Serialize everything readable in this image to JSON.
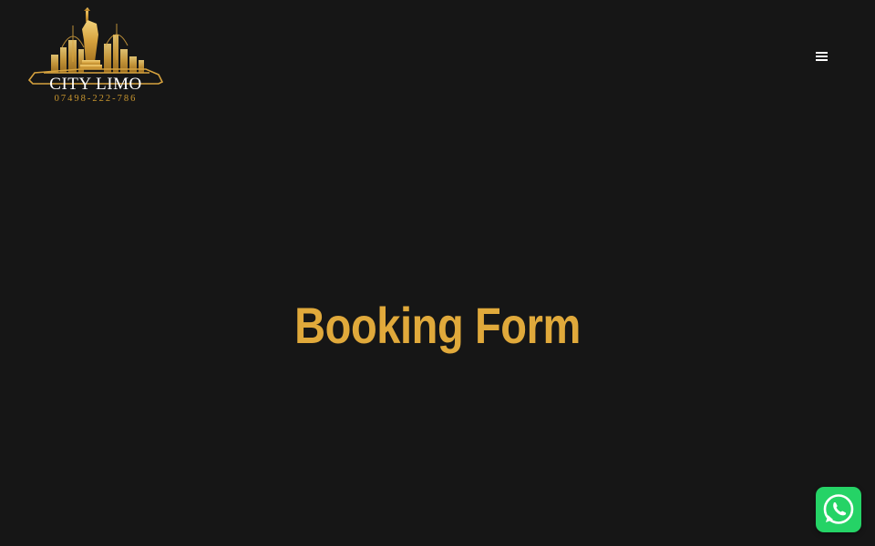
{
  "header": {
    "logo": {
      "name": "CITY LIMO",
      "phone": "07498-222-786"
    },
    "menu_icon": "hamburger-menu-icon"
  },
  "hero": {
    "title": "Booking Form"
  },
  "floating": {
    "whatsapp_icon": "whatsapp-icon"
  },
  "colors": {
    "background": "#161616",
    "accent_gold": "#e0a93b",
    "whatsapp_green": "#25d366"
  }
}
